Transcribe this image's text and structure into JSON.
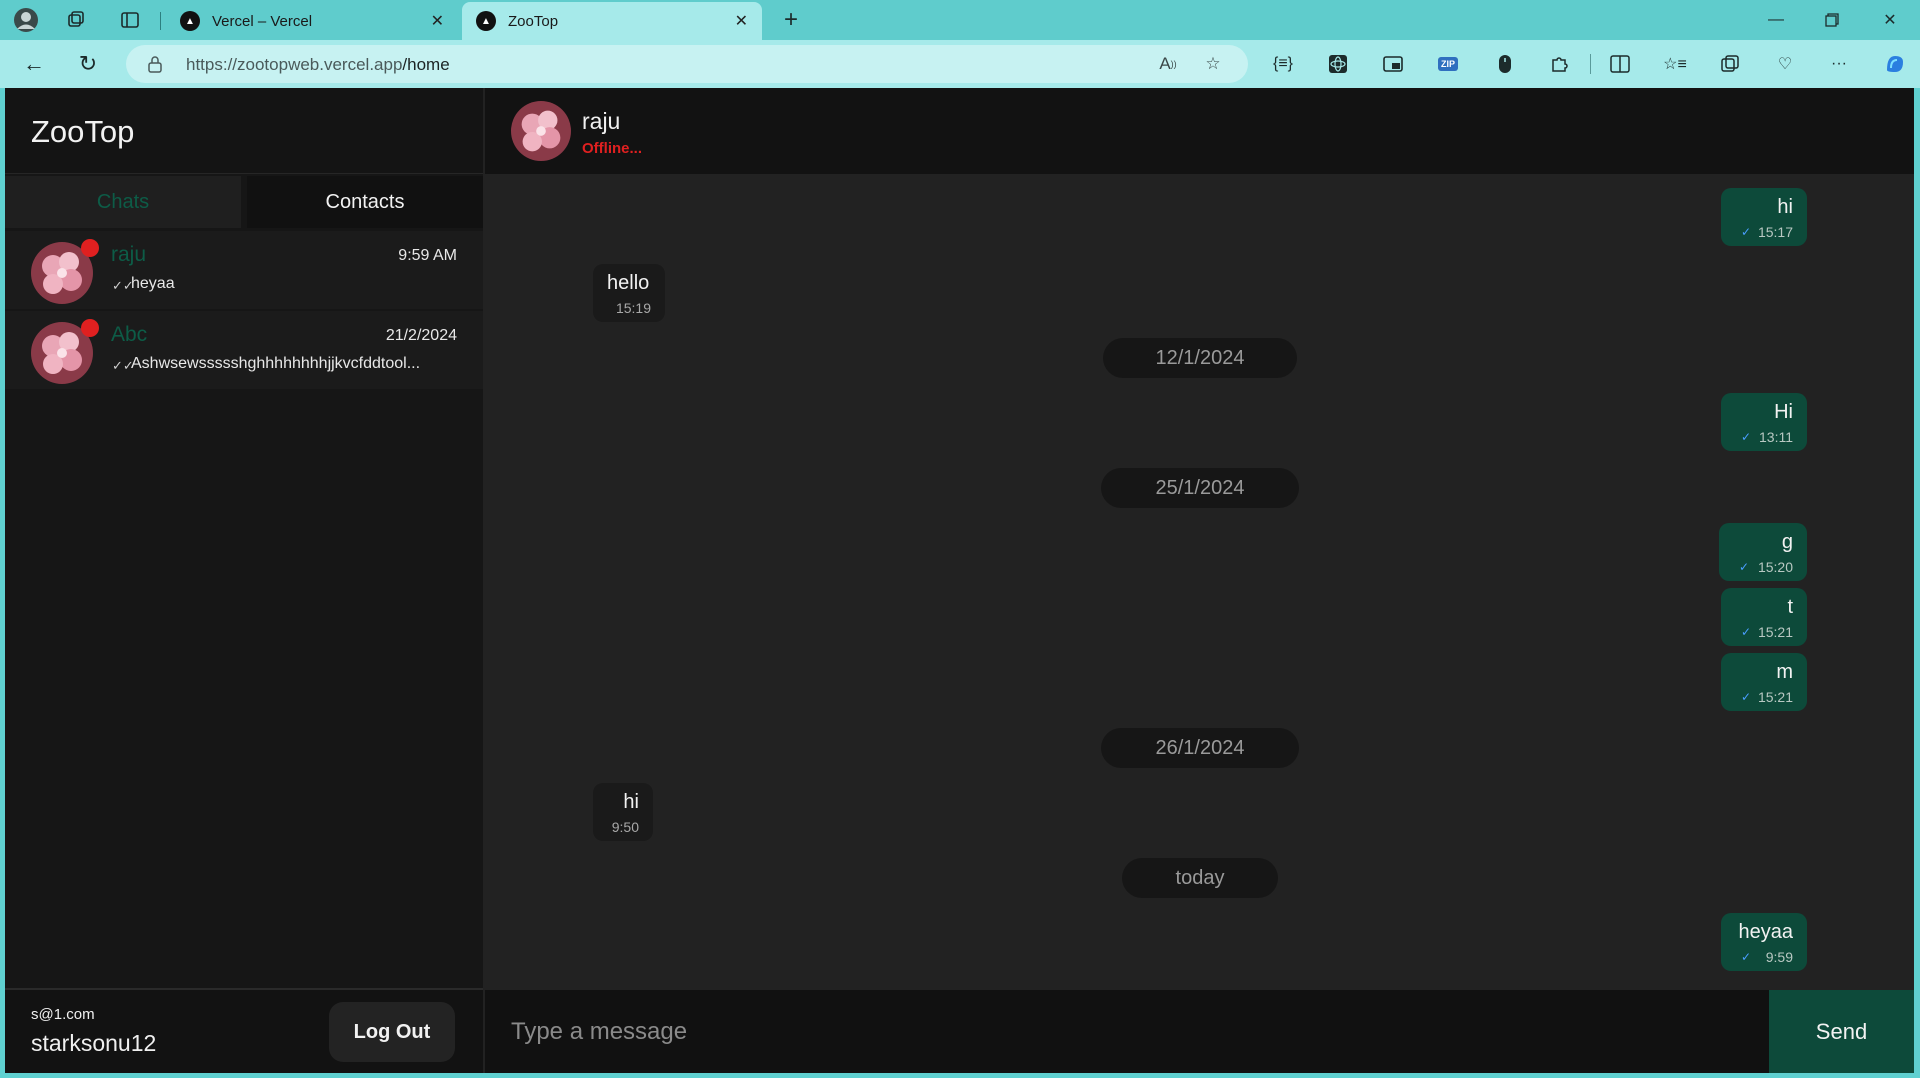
{
  "browser": {
    "tabs": [
      {
        "title": "Vercel – Vercel",
        "active": false
      },
      {
        "title": "ZooTop",
        "active": true
      }
    ],
    "url_host": "https://zootopweb.vercel.app",
    "url_path": "/home",
    "extension_icons": [
      "braces-icon",
      "atom-icon",
      "picture-in-picture-icon",
      "zip-icon",
      "mouse-icon",
      "puzzle-icon"
    ]
  },
  "app": {
    "brand": "ZooTop",
    "tabs": {
      "chats": "Chats",
      "contacts": "Contacts"
    },
    "chats": [
      {
        "name": "raju",
        "time": "9:59 AM",
        "last": "heyaa",
        "tick": "✓✓"
      },
      {
        "name": "Abc",
        "time": "21/2/2024",
        "last": "Ashwsewssssshghhhhhhhhjjkvcfddtool...",
        "tick": "✓✓"
      }
    ],
    "user": {
      "email": "s@1.com",
      "username": "starksonu12",
      "logout": "Log Out"
    },
    "header": {
      "name": "raju",
      "status": "Offline..."
    },
    "messages": [
      {
        "kind": "out",
        "text": "hi",
        "time": "15:17"
      },
      {
        "kind": "in",
        "text": "hello",
        "time": "15:19"
      },
      {
        "kind": "date",
        "text": "12/1/2024"
      },
      {
        "kind": "out",
        "text": "Hi",
        "time": "13:11"
      },
      {
        "kind": "date",
        "text": "25/1/2024"
      },
      {
        "kind": "out",
        "text": "g",
        "time": "15:20"
      },
      {
        "kind": "out",
        "text": "t",
        "time": "15:21"
      },
      {
        "kind": "out",
        "text": "m",
        "time": "15:21"
      },
      {
        "kind": "date",
        "text": "26/1/2024"
      },
      {
        "kind": "in",
        "text": "hi",
        "time": "9:50"
      },
      {
        "kind": "date",
        "text": "today"
      },
      {
        "kind": "out",
        "text": "heyaa",
        "time": "9:59"
      }
    ],
    "composer": {
      "placeholder": "Type a message",
      "send": "Send"
    },
    "colors": {
      "accent": "#0d4a3a",
      "accent_text": "#0d5c47",
      "offline": "#e02020",
      "browser_frame": "#5fcccc"
    }
  }
}
